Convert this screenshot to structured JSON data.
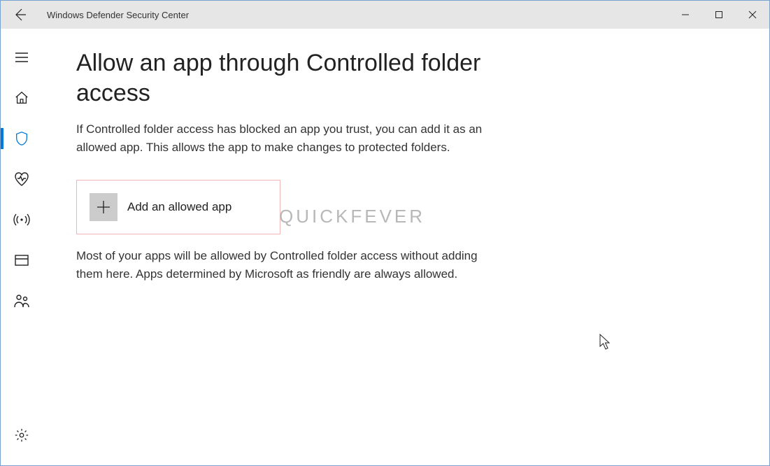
{
  "window": {
    "title": "Windows Defender Security Center"
  },
  "page": {
    "heading": "Allow an app through Controlled folder access",
    "description": "If Controlled folder access has blocked an app you trust, you can add it as an allowed app. This allows the app to make changes to protected folders.",
    "add_button_label": "Add an allowed app",
    "info_text": "Most of your apps will be allowed by Controlled folder access without adding them here. Apps determined by Microsoft as friendly are always allowed."
  },
  "watermark": "QUICKFEVER"
}
